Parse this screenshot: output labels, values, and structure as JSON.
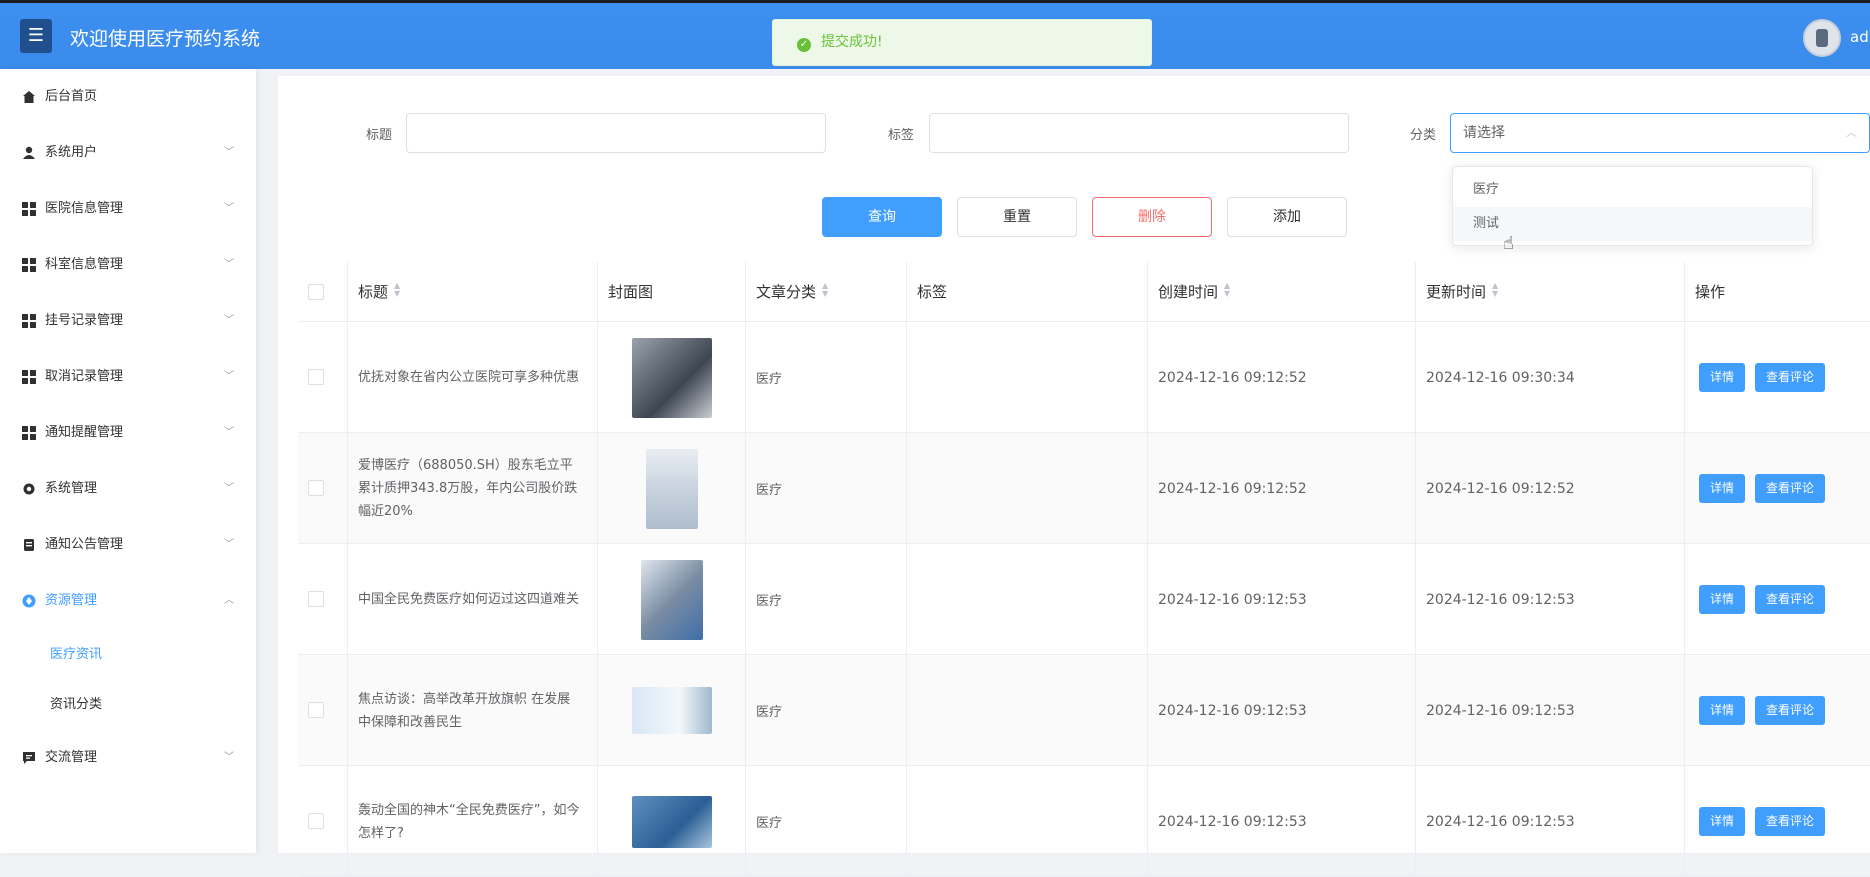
{
  "header": {
    "menu_icon": "hamburger-icon",
    "title": "欢迎使用医疗预约系统",
    "toast_text": "提交成功!",
    "user_name": "adm"
  },
  "sidebar": {
    "items": [
      {
        "label": "后台首页",
        "icon": "home-icon"
      },
      {
        "label": "系统用户",
        "icon": "user-icon"
      },
      {
        "label": "医院信息管理",
        "icon": "grid-icon"
      },
      {
        "label": "科室信息管理",
        "icon": "grid-icon"
      },
      {
        "label": "挂号记录管理",
        "icon": "grid-icon"
      },
      {
        "label": "取消记录管理",
        "icon": "grid-icon"
      },
      {
        "label": "通知提醒管理",
        "icon": "grid-icon"
      },
      {
        "label": "系统管理",
        "icon": "gear-icon"
      },
      {
        "label": "通知公告管理",
        "icon": "document-icon"
      },
      {
        "label": "资源管理",
        "icon": "circle-icon"
      },
      {
        "label": "交流管理",
        "icon": "chat-icon"
      }
    ],
    "sub_items": [
      "医疗资讯",
      "资讯分类"
    ]
  },
  "filters": {
    "title_label": "标题",
    "tag_label": "标签",
    "category_label": "分类",
    "category_placeholder": "请选择",
    "category_options": [
      "医疗",
      "测试"
    ]
  },
  "actions": {
    "search": "查询",
    "reset": "重置",
    "delete": "删除",
    "add": "添加"
  },
  "table": {
    "headers": [
      "标题",
      "封面图",
      "文章分类",
      "标签",
      "创建时间",
      "更新时间",
      "操作"
    ],
    "rows": [
      {
        "title": "优抚对象在省内公立医院可享多种优惠",
        "category": "医疗",
        "tag": "",
        "created": "2024-12-16 09:12:52",
        "updated": "2024-12-16 09:30:34"
      },
      {
        "title": "爱博医疗（688050.SH）股东毛立平累计质押343.8万股，年内公司股价跌幅近20%",
        "category": "医疗",
        "tag": "",
        "created": "2024-12-16 09:12:52",
        "updated": "2024-12-16 09:12:52"
      },
      {
        "title": "中国全民免费医疗如何迈过这四道难关",
        "category": "医疗",
        "tag": "",
        "created": "2024-12-16 09:12:53",
        "updated": "2024-12-16 09:12:53"
      },
      {
        "title": "焦点访谈：高举改革开放旗帜 在发展中保障和改善民生",
        "category": "医疗",
        "tag": "",
        "created": "2024-12-16 09:12:53",
        "updated": "2024-12-16 09:12:53"
      },
      {
        "title": "轰动全国的神木“全民免费医疗”，如今怎样了?",
        "category": "医疗",
        "tag": "",
        "created": "2024-12-16 09:12:53",
        "updated": "2024-12-16 09:12:53"
      }
    ],
    "detail_label": "详情",
    "comment_label": "查看评论"
  },
  "colors": {
    "primary": "#409eff",
    "header": "#3a8ee6",
    "danger": "#f56c6c",
    "success": "#67c23a"
  }
}
